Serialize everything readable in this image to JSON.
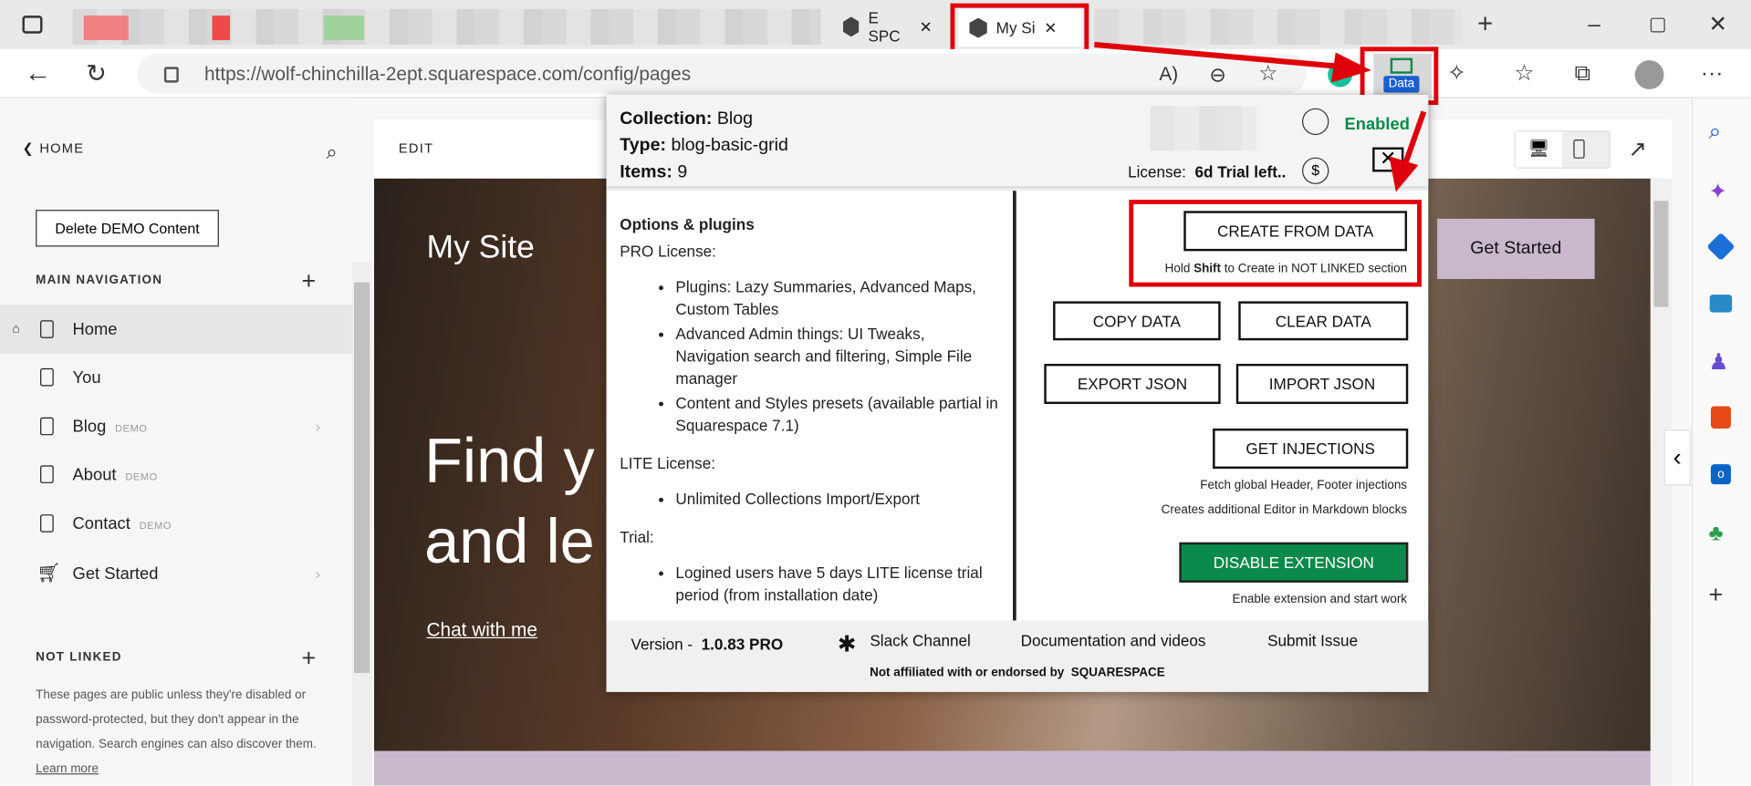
{
  "browser": {
    "tabs": [
      {
        "label": "E SPC"
      },
      {
        "label": "My Si"
      }
    ],
    "url": "https://wolf-chinchilla-2ept.squarespace.com/config/pages",
    "extension_badge": "Data"
  },
  "sidebar": {
    "back_label": "HOME",
    "delete_button": "Delete DEMO Content",
    "main_nav_title": "MAIN NAVIGATION",
    "items": [
      {
        "label": "Home"
      },
      {
        "label": "You"
      },
      {
        "label": "Blog",
        "badge": "DEMO"
      },
      {
        "label": "About",
        "badge": "DEMO"
      },
      {
        "label": "Contact",
        "badge": "DEMO"
      },
      {
        "label": "Get Started"
      }
    ],
    "not_linked_title": "NOT LINKED",
    "not_linked_text": "These pages are public unless they're disabled or password-protected, but they don't appear in the navigation. Search engines can also discover them.",
    "learn_more": "Learn more"
  },
  "preview": {
    "edit_label": "EDIT",
    "site_title": "My Site",
    "hero_line1": "Find y",
    "hero_line2": "and le",
    "cta_link": "Chat with me",
    "get_started": "Get Started"
  },
  "popup": {
    "collection_label": "Collection:",
    "collection": "Blog",
    "type_label": "Type:",
    "type": "blog-basic-grid",
    "items_label": "Items:",
    "items": "9",
    "status": "Enabled",
    "license_label": "License:",
    "license": "6d Trial left..",
    "options_title": "Options & plugins",
    "pro_title": "PRO License:",
    "pro_items": [
      "Plugins: Lazy Summaries, Advanced Maps, Custom Tables",
      "Advanced Admin things: UI Tweaks, Navigation search and filtering, Simple File manager",
      "Content and Styles presets (available partial in Squarespace 7.1)"
    ],
    "lite_title": "LITE License:",
    "lite_items": [
      "Unlimited Collections Import/Export"
    ],
    "trial_title": "Trial:",
    "trial_items": [
      "Logined users have 5 days LITE license trial period (from installation date)"
    ],
    "create_button": "CREATE FROM DATA",
    "create_note_pre": "Hold ",
    "create_note_bold": "Shift",
    "create_note_post": " to Create in NOT LINKED section",
    "copy_button": "COPY DATA",
    "clear_button": "CLEAR DATA",
    "export_button": "EXPORT JSON",
    "import_button": "IMPORT JSON",
    "injections_button": "GET INJECTIONS",
    "injections_note1": "Fetch global Header, Footer injections",
    "injections_note2": "Creates additional Editor in Markdown blocks",
    "disable_button": "DISABLE EXTENSION",
    "disable_note": "Enable extension and start work",
    "version_label": "Version -",
    "version": "1.0.83 PRO",
    "slack": "Slack Channel",
    "docs": "Documentation and videos",
    "submit": "Submit Issue",
    "disclaimer": "Not affiliated with or endorsed by  SQUARESPACE"
  },
  "colors": {
    "accent_red": "#e0000b",
    "enabled_green": "#0a8a4a",
    "disable_button": "#0a8a4a",
    "lavender": "#c9b8cc"
  }
}
